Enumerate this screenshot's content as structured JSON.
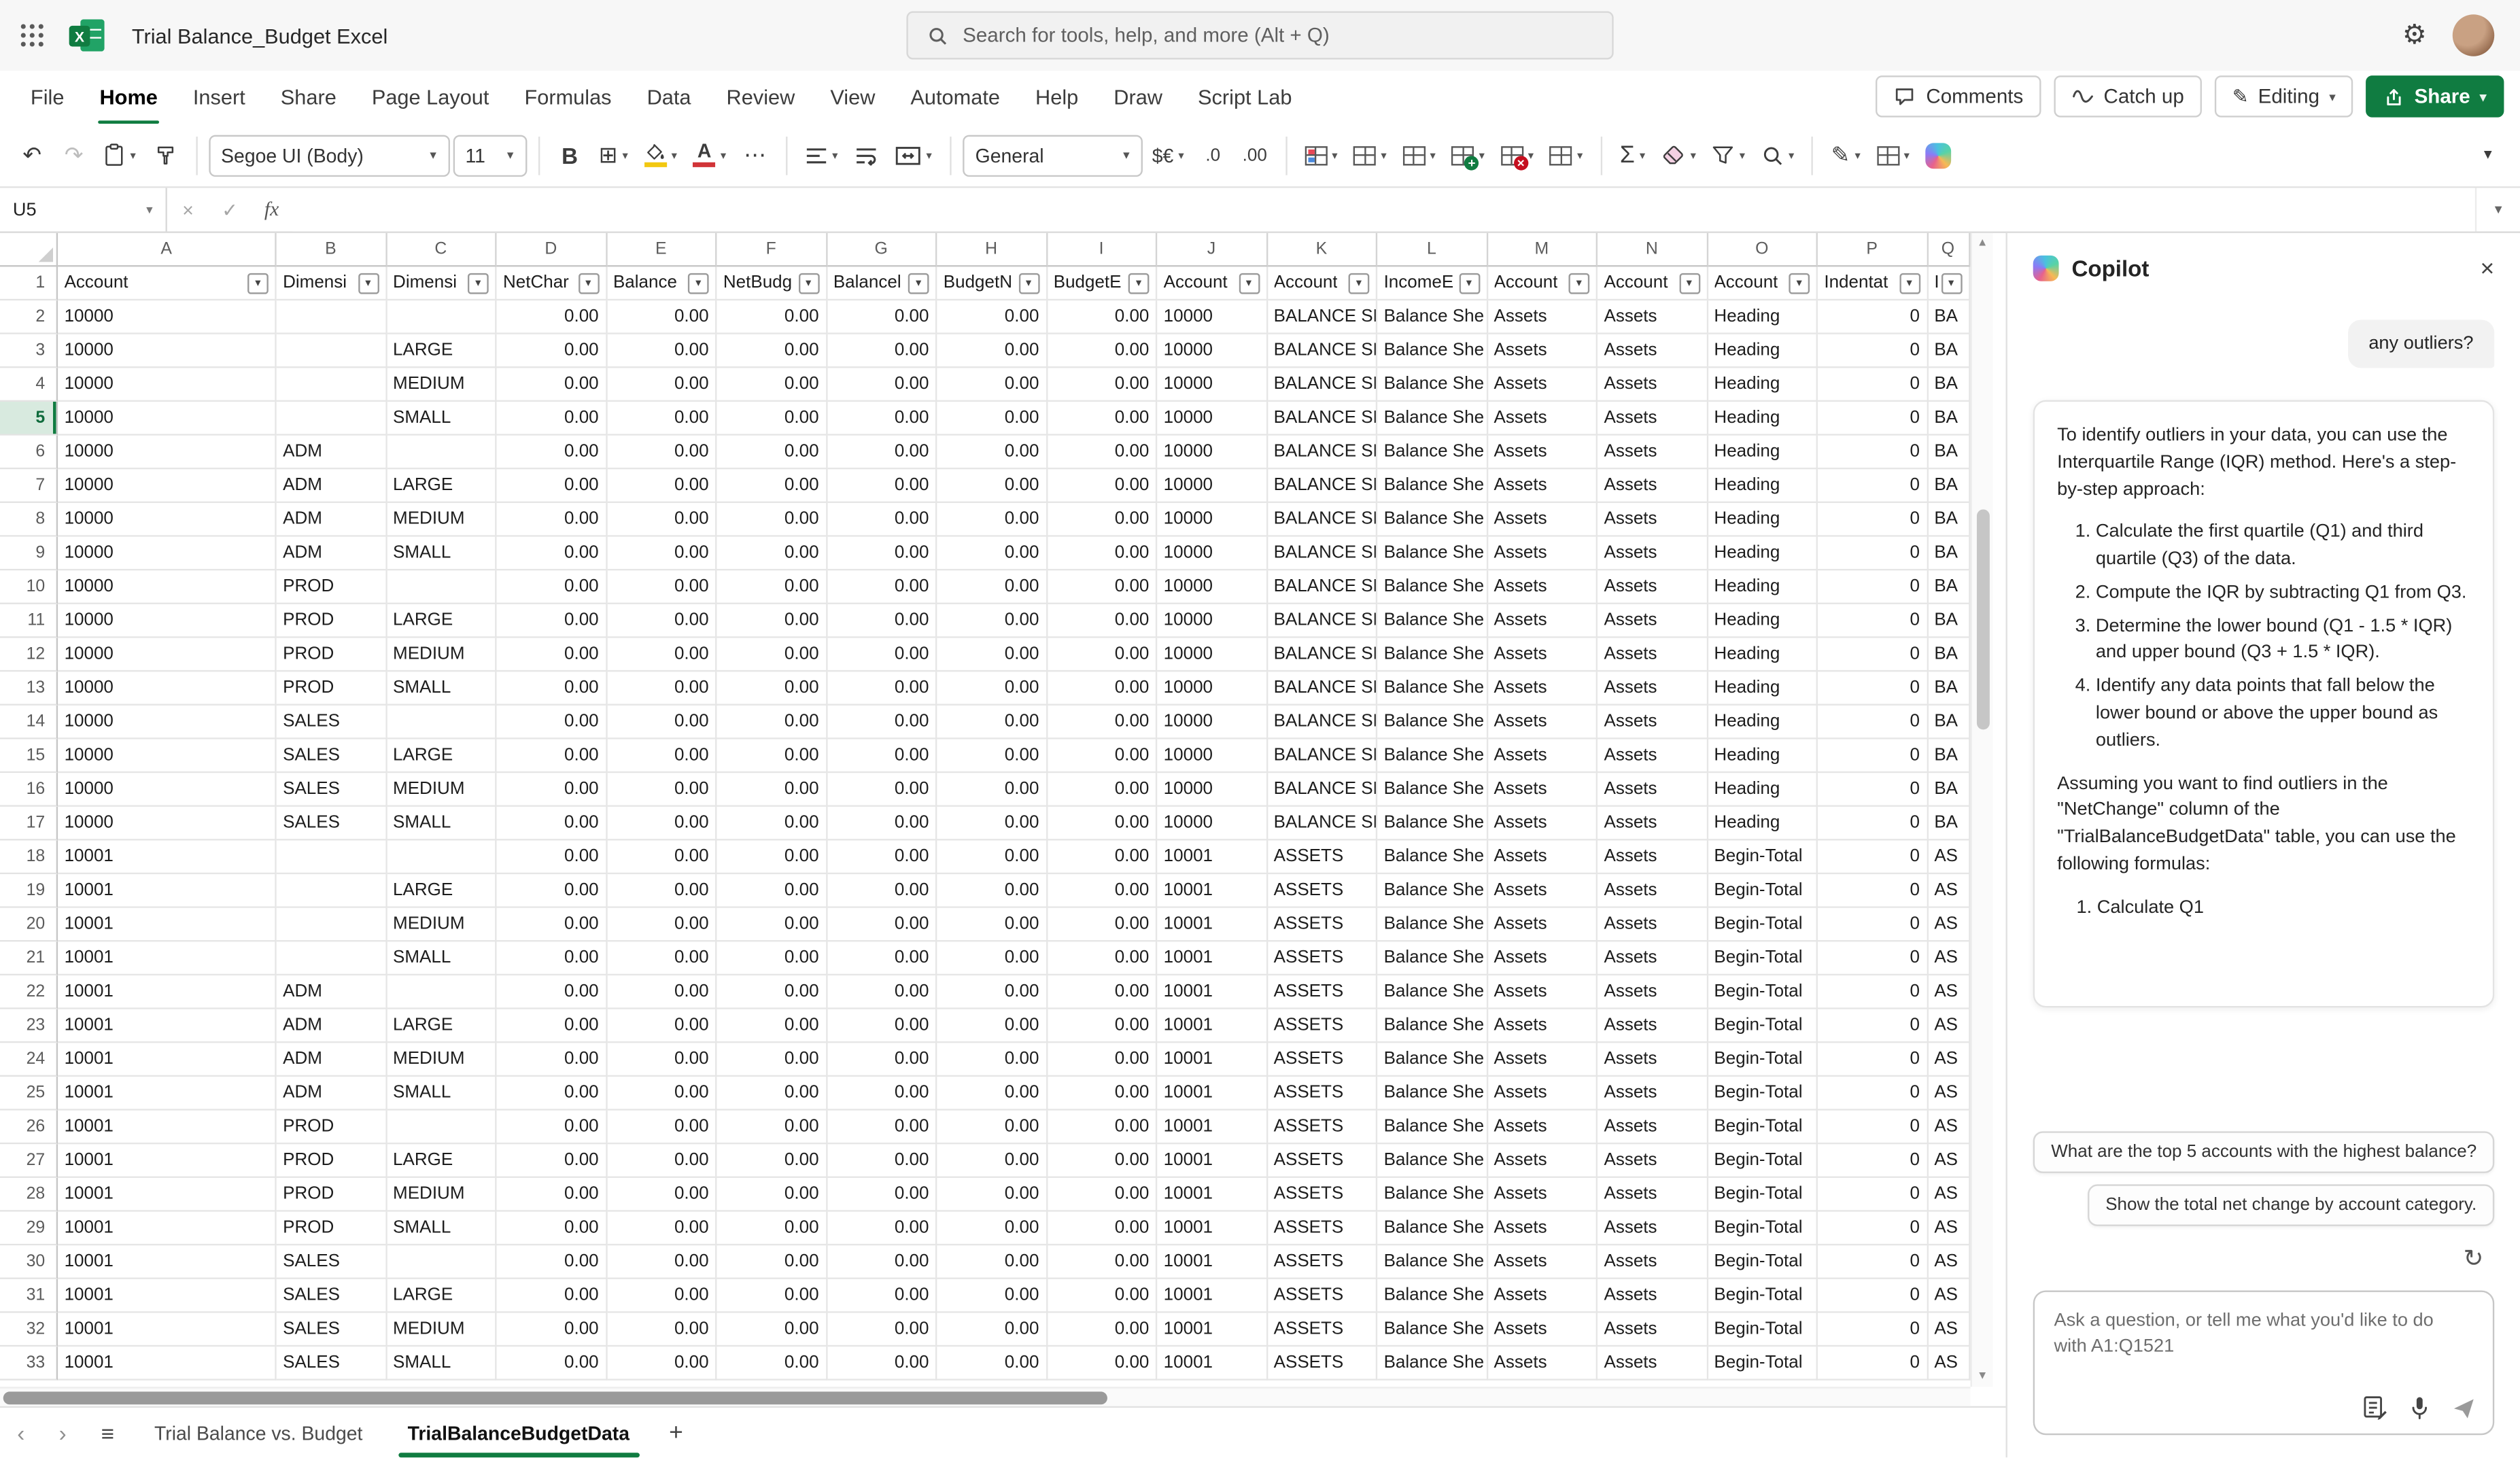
{
  "topbar": {
    "title": "Trial Balance_Budget Excel",
    "search_placeholder": "Search for tools, help, and more (Alt + Q)"
  },
  "ribbon": {
    "tabs": [
      "File",
      "Home",
      "Insert",
      "Share",
      "Page Layout",
      "Formulas",
      "Data",
      "Review",
      "View",
      "Automate",
      "Help",
      "Draw",
      "Script Lab"
    ],
    "active_tab": "Home",
    "comments_label": "Comments",
    "catchup_label": "Catch up",
    "editing_label": "Editing",
    "share_label": "Share"
  },
  "toolbar": {
    "font_name": "Segoe UI (Body)",
    "font_size": "11",
    "number_format": "General"
  },
  "formula_bar": {
    "name_box": "U5"
  },
  "grid": {
    "column_letters": [
      "A",
      "B",
      "C",
      "D",
      "E",
      "F",
      "G",
      "H",
      "I",
      "J",
      "K",
      "L",
      "M",
      "N",
      "O",
      "P",
      "Q"
    ],
    "header_row": [
      "Account",
      "Dimensi",
      "Dimensi",
      "NetChar",
      "Balance",
      "NetBudg",
      "Balancel",
      "BudgetN",
      "BudgetE",
      "Account",
      "Account",
      "IncomeE",
      "Account",
      "Account",
      "Account",
      "Indentat",
      "Inc"
    ],
    "selected_row": 5,
    "rows": [
      {
        "n": 2,
        "cells": [
          "10000",
          "",
          "",
          "0.00",
          "0.00",
          "0.00",
          "0.00",
          "0.00",
          "0.00",
          "10000",
          "BALANCE SH",
          "Balance She",
          "Assets",
          "Assets",
          "Heading",
          "0",
          "BA"
        ]
      },
      {
        "n": 3,
        "cells": [
          "10000",
          "",
          "LARGE",
          "0.00",
          "0.00",
          "0.00",
          "0.00",
          "0.00",
          "0.00",
          "10000",
          "BALANCE SH",
          "Balance She",
          "Assets",
          "Assets",
          "Heading",
          "0",
          "BA"
        ]
      },
      {
        "n": 4,
        "cells": [
          "10000",
          "",
          "MEDIUM",
          "0.00",
          "0.00",
          "0.00",
          "0.00",
          "0.00",
          "0.00",
          "10000",
          "BALANCE SH",
          "Balance She",
          "Assets",
          "Assets",
          "Heading",
          "0",
          "BA"
        ]
      },
      {
        "n": 5,
        "cells": [
          "10000",
          "",
          "SMALL",
          "0.00",
          "0.00",
          "0.00",
          "0.00",
          "0.00",
          "0.00",
          "10000",
          "BALANCE SH",
          "Balance She",
          "Assets",
          "Assets",
          "Heading",
          "0",
          "BA"
        ]
      },
      {
        "n": 6,
        "cells": [
          "10000",
          "ADM",
          "",
          "0.00",
          "0.00",
          "0.00",
          "0.00",
          "0.00",
          "0.00",
          "10000",
          "BALANCE SH",
          "Balance She",
          "Assets",
          "Assets",
          "Heading",
          "0",
          "BA"
        ]
      },
      {
        "n": 7,
        "cells": [
          "10000",
          "ADM",
          "LARGE",
          "0.00",
          "0.00",
          "0.00",
          "0.00",
          "0.00",
          "0.00",
          "10000",
          "BALANCE SH",
          "Balance She",
          "Assets",
          "Assets",
          "Heading",
          "0",
          "BA"
        ]
      },
      {
        "n": 8,
        "cells": [
          "10000",
          "ADM",
          "MEDIUM",
          "0.00",
          "0.00",
          "0.00",
          "0.00",
          "0.00",
          "0.00",
          "10000",
          "BALANCE SH",
          "Balance She",
          "Assets",
          "Assets",
          "Heading",
          "0",
          "BA"
        ]
      },
      {
        "n": 9,
        "cells": [
          "10000",
          "ADM",
          "SMALL",
          "0.00",
          "0.00",
          "0.00",
          "0.00",
          "0.00",
          "0.00",
          "10000",
          "BALANCE SH",
          "Balance She",
          "Assets",
          "Assets",
          "Heading",
          "0",
          "BA"
        ]
      },
      {
        "n": 10,
        "cells": [
          "10000",
          "PROD",
          "",
          "0.00",
          "0.00",
          "0.00",
          "0.00",
          "0.00",
          "0.00",
          "10000",
          "BALANCE SH",
          "Balance She",
          "Assets",
          "Assets",
          "Heading",
          "0",
          "BA"
        ]
      },
      {
        "n": 11,
        "cells": [
          "10000",
          "PROD",
          "LARGE",
          "0.00",
          "0.00",
          "0.00",
          "0.00",
          "0.00",
          "0.00",
          "10000",
          "BALANCE SH",
          "Balance She",
          "Assets",
          "Assets",
          "Heading",
          "0",
          "BA"
        ]
      },
      {
        "n": 12,
        "cells": [
          "10000",
          "PROD",
          "MEDIUM",
          "0.00",
          "0.00",
          "0.00",
          "0.00",
          "0.00",
          "0.00",
          "10000",
          "BALANCE SH",
          "Balance She",
          "Assets",
          "Assets",
          "Heading",
          "0",
          "BA"
        ]
      },
      {
        "n": 13,
        "cells": [
          "10000",
          "PROD",
          "SMALL",
          "0.00",
          "0.00",
          "0.00",
          "0.00",
          "0.00",
          "0.00",
          "10000",
          "BALANCE SH",
          "Balance She",
          "Assets",
          "Assets",
          "Heading",
          "0",
          "BA"
        ]
      },
      {
        "n": 14,
        "cells": [
          "10000",
          "SALES",
          "",
          "0.00",
          "0.00",
          "0.00",
          "0.00",
          "0.00",
          "0.00",
          "10000",
          "BALANCE SH",
          "Balance She",
          "Assets",
          "Assets",
          "Heading",
          "0",
          "BA"
        ]
      },
      {
        "n": 15,
        "cells": [
          "10000",
          "SALES",
          "LARGE",
          "0.00",
          "0.00",
          "0.00",
          "0.00",
          "0.00",
          "0.00",
          "10000",
          "BALANCE SH",
          "Balance She",
          "Assets",
          "Assets",
          "Heading",
          "0",
          "BA"
        ]
      },
      {
        "n": 16,
        "cells": [
          "10000",
          "SALES",
          "MEDIUM",
          "0.00",
          "0.00",
          "0.00",
          "0.00",
          "0.00",
          "0.00",
          "10000",
          "BALANCE SH",
          "Balance She",
          "Assets",
          "Assets",
          "Heading",
          "0",
          "BA"
        ]
      },
      {
        "n": 17,
        "cells": [
          "10000",
          "SALES",
          "SMALL",
          "0.00",
          "0.00",
          "0.00",
          "0.00",
          "0.00",
          "0.00",
          "10000",
          "BALANCE SH",
          "Balance She",
          "Assets",
          "Assets",
          "Heading",
          "0",
          "BA"
        ]
      },
      {
        "n": 18,
        "cells": [
          "10001",
          "",
          "",
          "0.00",
          "0.00",
          "0.00",
          "0.00",
          "0.00",
          "0.00",
          "10001",
          "ASSETS",
          "Balance She",
          "Assets",
          "Assets",
          "Begin-Total",
          "0",
          "AS"
        ]
      },
      {
        "n": 19,
        "cells": [
          "10001",
          "",
          "LARGE",
          "0.00",
          "0.00",
          "0.00",
          "0.00",
          "0.00",
          "0.00",
          "10001",
          "ASSETS",
          "Balance She",
          "Assets",
          "Assets",
          "Begin-Total",
          "0",
          "AS"
        ]
      },
      {
        "n": 20,
        "cells": [
          "10001",
          "",
          "MEDIUM",
          "0.00",
          "0.00",
          "0.00",
          "0.00",
          "0.00",
          "0.00",
          "10001",
          "ASSETS",
          "Balance She",
          "Assets",
          "Assets",
          "Begin-Total",
          "0",
          "AS"
        ]
      },
      {
        "n": 21,
        "cells": [
          "10001",
          "",
          "SMALL",
          "0.00",
          "0.00",
          "0.00",
          "0.00",
          "0.00",
          "0.00",
          "10001",
          "ASSETS",
          "Balance She",
          "Assets",
          "Assets",
          "Begin-Total",
          "0",
          "AS"
        ]
      },
      {
        "n": 22,
        "cells": [
          "10001",
          "ADM",
          "",
          "0.00",
          "0.00",
          "0.00",
          "0.00",
          "0.00",
          "0.00",
          "10001",
          "ASSETS",
          "Balance She",
          "Assets",
          "Assets",
          "Begin-Total",
          "0",
          "AS"
        ]
      },
      {
        "n": 23,
        "cells": [
          "10001",
          "ADM",
          "LARGE",
          "0.00",
          "0.00",
          "0.00",
          "0.00",
          "0.00",
          "0.00",
          "10001",
          "ASSETS",
          "Balance She",
          "Assets",
          "Assets",
          "Begin-Total",
          "0",
          "AS"
        ]
      },
      {
        "n": 24,
        "cells": [
          "10001",
          "ADM",
          "MEDIUM",
          "0.00",
          "0.00",
          "0.00",
          "0.00",
          "0.00",
          "0.00",
          "10001",
          "ASSETS",
          "Balance She",
          "Assets",
          "Assets",
          "Begin-Total",
          "0",
          "AS"
        ]
      },
      {
        "n": 25,
        "cells": [
          "10001",
          "ADM",
          "SMALL",
          "0.00",
          "0.00",
          "0.00",
          "0.00",
          "0.00",
          "0.00",
          "10001",
          "ASSETS",
          "Balance She",
          "Assets",
          "Assets",
          "Begin-Total",
          "0",
          "AS"
        ]
      },
      {
        "n": 26,
        "cells": [
          "10001",
          "PROD",
          "",
          "0.00",
          "0.00",
          "0.00",
          "0.00",
          "0.00",
          "0.00",
          "10001",
          "ASSETS",
          "Balance She",
          "Assets",
          "Assets",
          "Begin-Total",
          "0",
          "AS"
        ]
      },
      {
        "n": 27,
        "cells": [
          "10001",
          "PROD",
          "LARGE",
          "0.00",
          "0.00",
          "0.00",
          "0.00",
          "0.00",
          "0.00",
          "10001",
          "ASSETS",
          "Balance She",
          "Assets",
          "Assets",
          "Begin-Total",
          "0",
          "AS"
        ]
      },
      {
        "n": 28,
        "cells": [
          "10001",
          "PROD",
          "MEDIUM",
          "0.00",
          "0.00",
          "0.00",
          "0.00",
          "0.00",
          "0.00",
          "10001",
          "ASSETS",
          "Balance She",
          "Assets",
          "Assets",
          "Begin-Total",
          "0",
          "AS"
        ]
      },
      {
        "n": 29,
        "cells": [
          "10001",
          "PROD",
          "SMALL",
          "0.00",
          "0.00",
          "0.00",
          "0.00",
          "0.00",
          "0.00",
          "10001",
          "ASSETS",
          "Balance She",
          "Assets",
          "Assets",
          "Begin-Total",
          "0",
          "AS"
        ]
      },
      {
        "n": 30,
        "cells": [
          "10001",
          "SALES",
          "",
          "0.00",
          "0.00",
          "0.00",
          "0.00",
          "0.00",
          "0.00",
          "10001",
          "ASSETS",
          "Balance She",
          "Assets",
          "Assets",
          "Begin-Total",
          "0",
          "AS"
        ]
      },
      {
        "n": 31,
        "cells": [
          "10001",
          "SALES",
          "LARGE",
          "0.00",
          "0.00",
          "0.00",
          "0.00",
          "0.00",
          "0.00",
          "10001",
          "ASSETS",
          "Balance She",
          "Assets",
          "Assets",
          "Begin-Total",
          "0",
          "AS"
        ]
      },
      {
        "n": 32,
        "cells": [
          "10001",
          "SALES",
          "MEDIUM",
          "0.00",
          "0.00",
          "0.00",
          "0.00",
          "0.00",
          "0.00",
          "10001",
          "ASSETS",
          "Balance She",
          "Assets",
          "Assets",
          "Begin-Total",
          "0",
          "AS"
        ]
      },
      {
        "n": 33,
        "cells": [
          "10001",
          "SALES",
          "SMALL",
          "0.00",
          "0.00",
          "0.00",
          "0.00",
          "0.00",
          "0.00",
          "10001",
          "ASSETS",
          "Balance She",
          "Assets",
          "Assets",
          "Begin-Total",
          "0",
          "AS"
        ]
      }
    ]
  },
  "sheet_bar": {
    "tabs": [
      {
        "label": "Trial Balance vs. Budget",
        "active": false
      },
      {
        "label": "TrialBalanceBudgetData",
        "active": true
      }
    ]
  },
  "copilot": {
    "title": "Copilot",
    "user_message": "any outliers?",
    "response": {
      "intro": "To identify outliers in your data, you can use the Interquartile Range (IQR) method. Here's a step-by-step approach:",
      "steps": [
        "Calculate the first quartile (Q1) and third quartile (Q3) of the data.",
        "Compute the IQR by subtracting Q1 from Q3.",
        "Determine the lower bound (Q1 - 1.5 * IQR) and upper bound (Q3 + 1.5 * IQR).",
        "Identify any data points that fall below the lower bound or above the upper bound as outliers."
      ],
      "followup": "Assuming you want to find outliers in the \"NetChange\" column of the \"TrialBalanceBudgetData\" table, you can use the following formulas:",
      "partial": "1. Calculate Q1"
    },
    "suggestions": [
      "What are the top 5 accounts with the highest balance?",
      "Show the total net change by account category."
    ],
    "input_placeholder": "Ask a question, or tell me what you'd like to do with A1:Q1521"
  },
  "icons": {
    "undo": "↶",
    "redo": "↷",
    "dropdown": "▾",
    "bold": "B",
    "borders": "⊞",
    "font_color": "A",
    "more": "⋯",
    "currency": "$€",
    "decimal_decrease": ".0",
    "decimal_increase": ".00",
    "sigma": "Σ",
    "pencil": "✎",
    "gear": "⚙",
    "close": "×",
    "cancel": "×",
    "check": "✓",
    "fx": "fx",
    "refresh": "↻",
    "hamburger": "≡",
    "nav_left": "‹",
    "nav_right": "›",
    "add_sheet": "+",
    "collapse": "▾",
    "expand_formula_bar": "▾"
  },
  "colors": {
    "accent_green": "#107C41",
    "fill_default": "#f2c811",
    "font_color_default": "#d13438"
  }
}
